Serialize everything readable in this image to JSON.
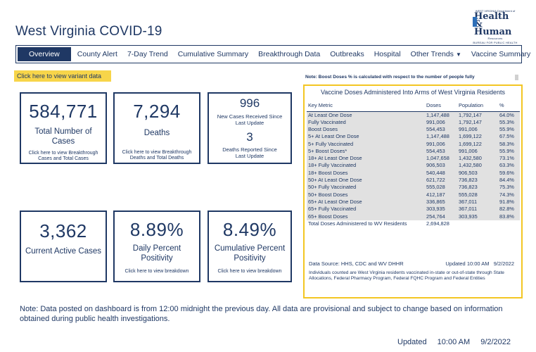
{
  "title": "West Virginia COVID-19",
  "logo": {
    "small_text": "WEST VIRGINIA Department of",
    "line1": "Health",
    "line2": "& Human",
    "line3": "Resources",
    "bureau": "BUREAU FOR PUBLIC HEALTH"
  },
  "nav": {
    "tabs": [
      "Overview",
      "County Alert",
      "7-Day Trend",
      "Cumulative Summary",
      "Breakthrough Data",
      "Outbreaks",
      "Hospital",
      "Other Trends",
      "Vaccine Summary"
    ],
    "active": "Overview"
  },
  "variant_link": "Click here to view variant data",
  "cards": {
    "total_cases": {
      "value": "584,771",
      "label": "Total Number of Cases",
      "link": "Click here to view Breakthrough Cases and Total Cases"
    },
    "deaths": {
      "value": "7,294",
      "label": "Deaths",
      "link": "Click here to view Breakthrough Deaths and Total Deaths"
    },
    "new_cases": {
      "value": "996",
      "label": "New Cases Received Since Last Update"
    },
    "new_deaths": {
      "value": "3",
      "label": "Deaths Reported Since Last Update"
    },
    "active_cases": {
      "value": "3,362",
      "label": "Current Active Cases"
    },
    "daily_positivity": {
      "value": "8.89%",
      "label": "Daily Percent Positivity",
      "link": "Click here to view breakdown"
    },
    "cumulative_positivity": {
      "value": "8.49%",
      "label": "Cumulative Percent Positivity",
      "link": "Click here to view breakdown"
    }
  },
  "boost_note": "Note: Boost Doses % is calculated with respect to the number of people fully",
  "vaccine": {
    "title": "Vaccine Doses Administered Into Arms of West Virginia Residents",
    "columns": [
      "Key Metric",
      "Doses",
      "Population",
      "%"
    ],
    "rows": [
      [
        "At Least One Dose",
        "1,147,488",
        "1,792,147",
        "64.0%"
      ],
      [
        "Fully Vaccinated",
        "991,006",
        "1,792,147",
        "55.3%"
      ],
      [
        "Boost Doses",
        "554,453",
        "991,006",
        "55.9%"
      ],
      [
        "5+ At Least One Dose",
        "1,147,488",
        "1,699,122",
        "67.5%"
      ],
      [
        "5+ Fully Vaccinated",
        "991,006",
        "1,699,122",
        "58.3%"
      ],
      [
        "5+ Boost Doses*",
        "554,453",
        "991,006",
        "55.9%"
      ],
      [
        "18+ At Least One Dose",
        "1,047,658",
        "1,432,580",
        "73.1%"
      ],
      [
        "18+ Fully Vaccinated",
        "906,503",
        "1,432,580",
        "63.3%"
      ],
      [
        "18+ Boost Doses",
        "540,448",
        "906,503",
        "59.6%"
      ],
      [
        "50+ At Least One Dose",
        "621,722",
        "736,823",
        "84.4%"
      ],
      [
        "50+ Fully Vaccinated",
        "555,028",
        "736,823",
        "75.3%"
      ],
      [
        "50+ Boost Doses",
        "412,187",
        "555,028",
        "74.3%"
      ],
      [
        "65+ At Least One Dose",
        "336,865",
        "367,011",
        "91.8%"
      ],
      [
        "65+ Fully Vaccinated",
        "303,935",
        "367,011",
        "82.8%"
      ],
      [
        "65+ Boost Doses",
        "254,764",
        "303,935",
        "83.8%"
      ]
    ],
    "total_label": "Total Doses Administered to WV Residents",
    "total_value": "2,694,828",
    "source": "Data Source: HHS, CDC and WV DHHR",
    "updated_label": "Updated",
    "updated_time": "10:00 AM",
    "updated_date": "9/2/2022",
    "fine_print": "Individuals counted are West Virginia residents vaccinated in-state or out-of-state through State Allocations, Federal Pharmacy Program, Federal FQHC Program and Federal Entities"
  },
  "footnote": "Note: Data posted on dashboard is from 12:00 midnight the previous day. All data are provisional and subject to change based on information obtained during public health investigations.",
  "footer_updated": {
    "label": "Updated",
    "time": "10:00 AM",
    "date": "9/2/2022"
  }
}
